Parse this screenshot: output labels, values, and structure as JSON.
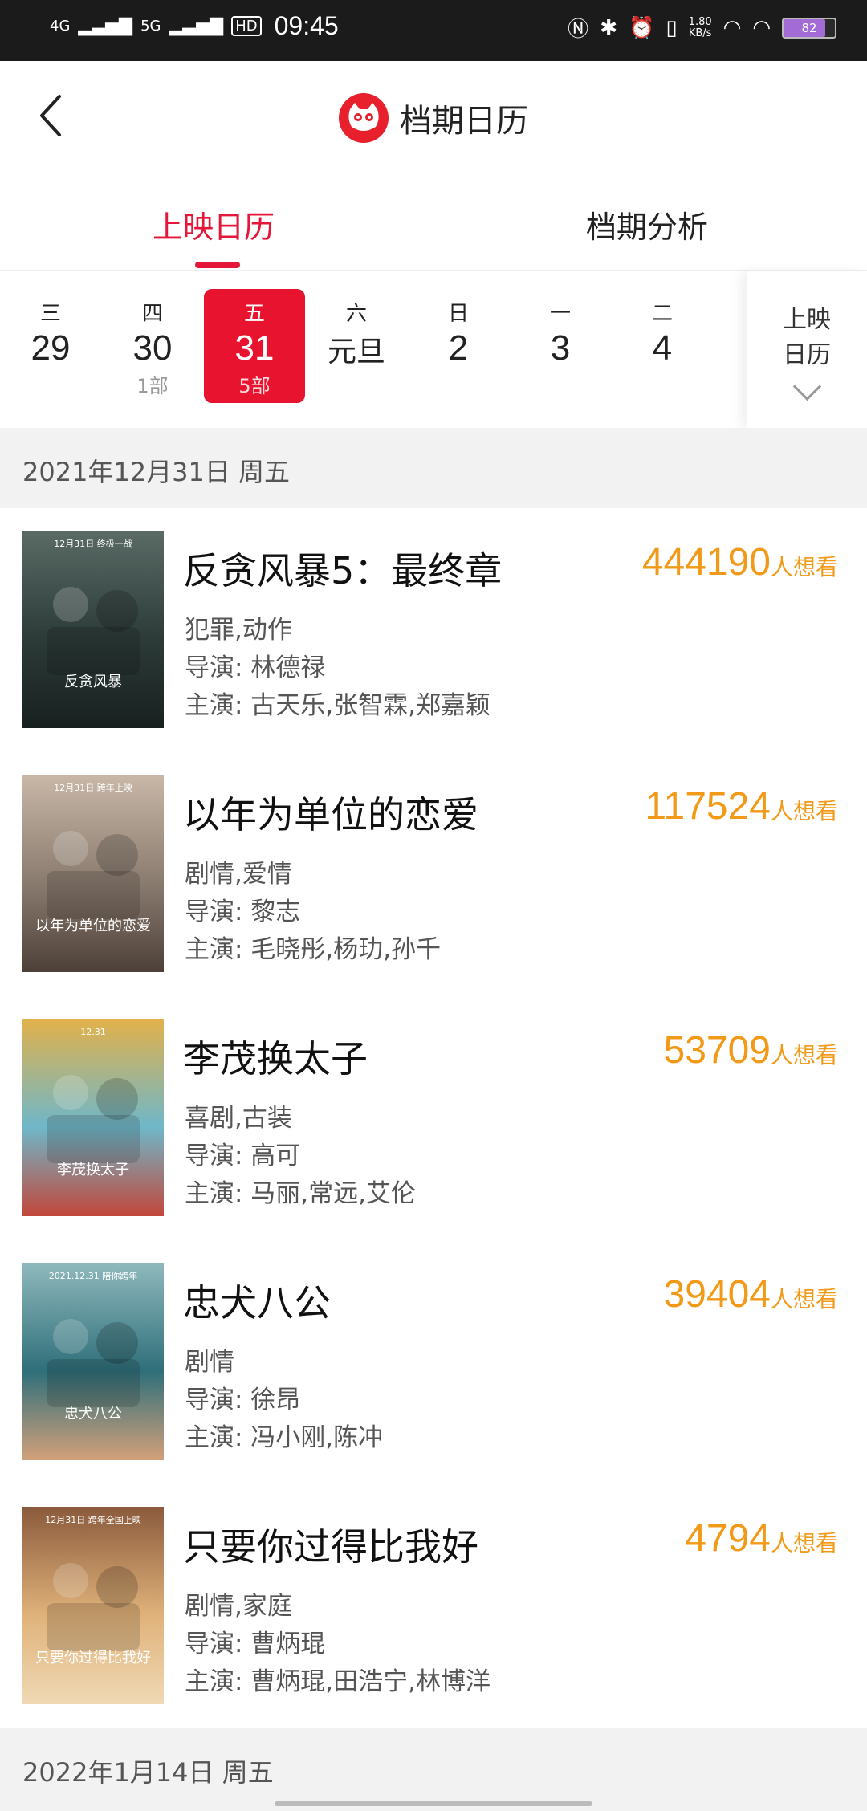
{
  "status_bar": {
    "network1": "4G",
    "network2": "5G",
    "hd": "HD",
    "time": "09:45",
    "netspeed_value": "1.80",
    "netspeed_unit": "KB/s",
    "battery": "82",
    "battery_level": 0.82
  },
  "header": {
    "title": "档期日历"
  },
  "tabs": [
    {
      "label": "上映日历"
    },
    {
      "label": "档期分析"
    }
  ],
  "date_bar": {
    "days": [
      {
        "weekday": "三",
        "date": "29",
        "count": ""
      },
      {
        "weekday": "四",
        "date": "30",
        "count": "1部"
      },
      {
        "weekday": "五",
        "date": "31",
        "count": "5部"
      },
      {
        "weekday": "六",
        "date": "元旦",
        "count": ""
      },
      {
        "weekday": "日",
        "date": "2",
        "count": ""
      },
      {
        "weekday": "一",
        "date": "3",
        "count": ""
      },
      {
        "weekday": "二",
        "date": "4",
        "count": ""
      }
    ],
    "calendar_button": {
      "line1": "上映",
      "line2": "日历"
    }
  },
  "section1": {
    "date_label": "2021年12月31日 周五"
  },
  "want_unit": "人想看",
  "movies": [
    {
      "title": "反贪风暴5：最终章",
      "genre": "犯罪,动作",
      "director": "导演: 林德禄",
      "cast": "主演: 古天乐,张智霖,郑嘉颖",
      "want": "444190",
      "poster_colors": [
        "#2c3b38",
        "#5a6b66",
        "#18201f"
      ],
      "poster_text": "反贪风暴",
      "poster_sub": "12月31日 终极一战"
    },
    {
      "title": "以年为单位的恋爱",
      "genre": "剧情,爱情",
      "director": "导演: 黎志",
      "cast": "主演: 毛晓彤,杨玏,孙千",
      "want": "117524",
      "poster_colors": [
        "#8a7b6f",
        "#c9b8a8",
        "#4d4038"
      ],
      "poster_text": "以年为单位的恋爱",
      "poster_sub": "12月31日 跨年上映"
    },
    {
      "title": "李茂换太子",
      "genre": "喜剧,古装",
      "director": "导演: 高可",
      "cast": "主演: 马丽,常远,艾伦",
      "want": "53709",
      "poster_colors": [
        "#6fb7c9",
        "#e2b14a",
        "#c2473b"
      ],
      "poster_text": "李茂换太子",
      "poster_sub": "12.31"
    },
    {
      "title": "忠犬八公",
      "genre": "剧情",
      "director": "导演: 徐昂",
      "cast": "主演: 冯小刚,陈冲",
      "want": "39404",
      "poster_colors": [
        "#2f6f7a",
        "#8fb9bd",
        "#d3a07a"
      ],
      "poster_text": "忠犬八公",
      "poster_sub": "2021.12.31 陪你跨年"
    },
    {
      "title": "只要你过得比我好",
      "genre": "剧情,家庭",
      "director": "导演: 曹炳琨",
      "cast": "主演: 曹炳琨,田浩宁,林博洋",
      "want": "4794",
      "poster_colors": [
        "#e0b27a",
        "#8a5a3c",
        "#f0d9b5"
      ],
      "poster_text": "只要你过得比我好",
      "poster_sub": "12月31日 跨年全国上映"
    }
  ],
  "section2": {
    "date_label": "2022年1月14日 周五"
  },
  "colors": {
    "accent": "#e4173a",
    "want_orange": "#f29a18",
    "section_bg": "#f2f2f2"
  }
}
